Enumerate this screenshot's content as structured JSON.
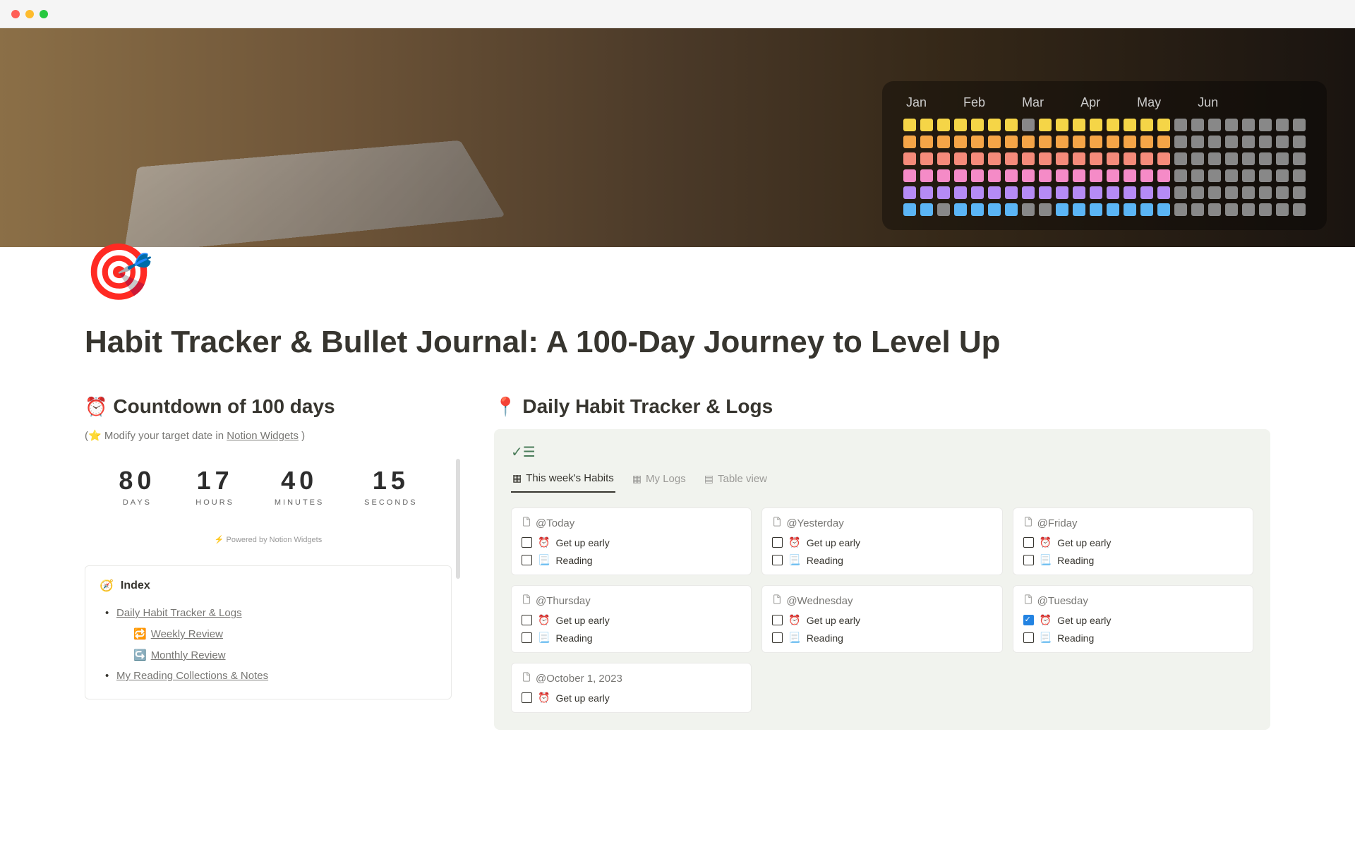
{
  "page": {
    "title": "Habit Tracker & Bullet Journal: A 100-Day Journey to Level Up",
    "icon": "🎯"
  },
  "heatmap": {
    "months": [
      "Jan",
      "Feb",
      "Mar",
      "Apr",
      "May",
      "Jun"
    ]
  },
  "left": {
    "countdown": {
      "title_emoji": "⏰",
      "title": "Countdown of 100 days",
      "subtitle_prefix": "(⭐ Modify your target date in ",
      "subtitle_link": "Notion Widgets",
      "subtitle_suffix": " )",
      "days": "80",
      "days_label": "DAYS",
      "hours": "17",
      "hours_label": "HOURS",
      "minutes": "40",
      "minutes_label": "MINUTES",
      "seconds": "15",
      "seconds_label": "SECONDS",
      "powered": "⚡ Powered by Notion Widgets"
    },
    "index": {
      "title": "Index",
      "items": [
        {
          "label": "Daily Habit Tracker & Logs",
          "type": "link"
        },
        {
          "label": "Weekly Review",
          "type": "sub",
          "emoji": "🔁"
        },
        {
          "label": "Monthly Review",
          "type": "sub",
          "emoji": "↪️"
        },
        {
          "label": "My Reading Collections & Notes",
          "type": "link"
        }
      ]
    }
  },
  "right": {
    "title_emoji": "📍",
    "title": "Daily Habit Tracker & Logs",
    "tabs": [
      {
        "label": "This week's Habits",
        "active": true,
        "icon": "▦"
      },
      {
        "label": "My Logs",
        "active": false,
        "icon": "▦"
      },
      {
        "label": "Table view",
        "active": false,
        "icon": "▤"
      }
    ],
    "habits": {
      "get_up": {
        "emoji": "⏰",
        "label": "Get up early"
      },
      "reading": {
        "emoji": "📃",
        "label": "Reading"
      }
    },
    "cards": [
      {
        "title": "@Today",
        "habits": [
          "get_up",
          "reading"
        ],
        "checked": []
      },
      {
        "title": "@Yesterday",
        "habits": [
          "get_up",
          "reading"
        ],
        "checked": []
      },
      {
        "title": "@Friday",
        "habits": [
          "get_up",
          "reading"
        ],
        "checked": []
      },
      {
        "title": "@Thursday",
        "habits": [
          "get_up",
          "reading"
        ],
        "checked": []
      },
      {
        "title": "@Wednesday",
        "habits": [
          "get_up",
          "reading"
        ],
        "checked": []
      },
      {
        "title": "@Tuesday",
        "habits": [
          "get_up",
          "reading"
        ],
        "checked": [
          "get_up"
        ]
      },
      {
        "title": "@October 1, 2023",
        "habits": [
          "get_up"
        ],
        "checked": [],
        "wide": true
      }
    ]
  }
}
